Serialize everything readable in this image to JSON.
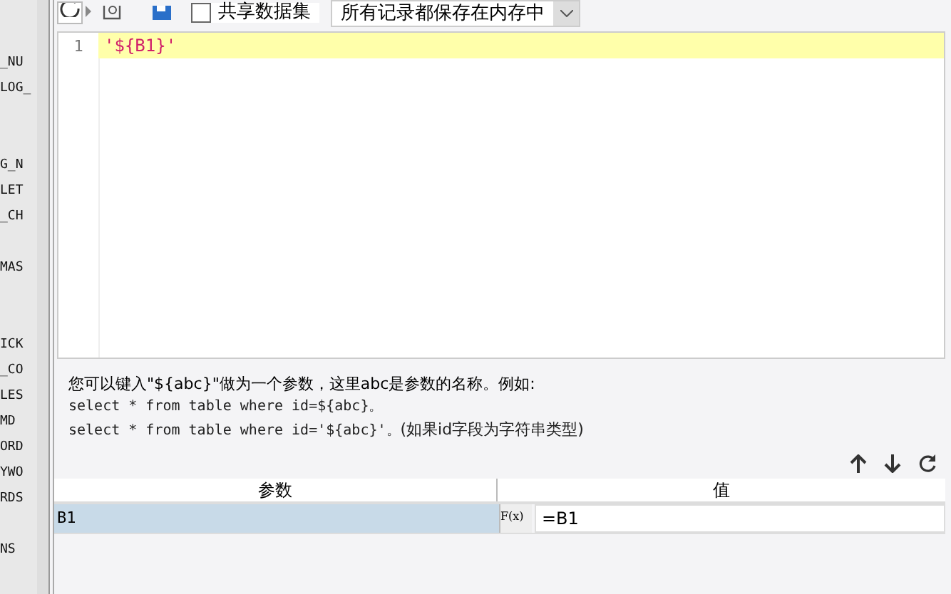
{
  "toolbar": {
    "shared_dataset": {
      "label": "共享数据集",
      "checked": false
    },
    "storage_select": {
      "value": "所有记录都保存在内存中"
    }
  },
  "side_list": [
    {
      "label": "_NU"
    },
    {
      "label": "LOG_"
    },
    {
      "label": "G_N"
    },
    {
      "label": "LET"
    },
    {
      "label": "_CH"
    },
    {
      "label": "MAS"
    },
    {
      "label": "ICK"
    },
    {
      "label": "_CO"
    },
    {
      "label": "LES"
    },
    {
      "label": "MD"
    },
    {
      "label": "ORD"
    },
    {
      "label": "YWO"
    },
    {
      "label": "RDS"
    },
    {
      "label": "NS"
    }
  ],
  "editor": {
    "lines": [
      {
        "number": "1",
        "code": "'${B1}'",
        "current": true
      }
    ]
  },
  "help": {
    "intro": "您可以键入\"${abc}\"做为一个参数，这里abc是参数的名称。例如:",
    "example_1": "select * from table where id=${abc}。",
    "example_2": "select * from table where id='${abc}'。",
    "example_2_note": "(如果id字段为字符串类型)"
  },
  "params_table": {
    "columns": [
      "参数",
      "值"
    ],
    "rows": [
      {
        "name": "B1",
        "value": "=B1",
        "selected": true
      }
    ],
    "formula_button": "F(x)"
  }
}
